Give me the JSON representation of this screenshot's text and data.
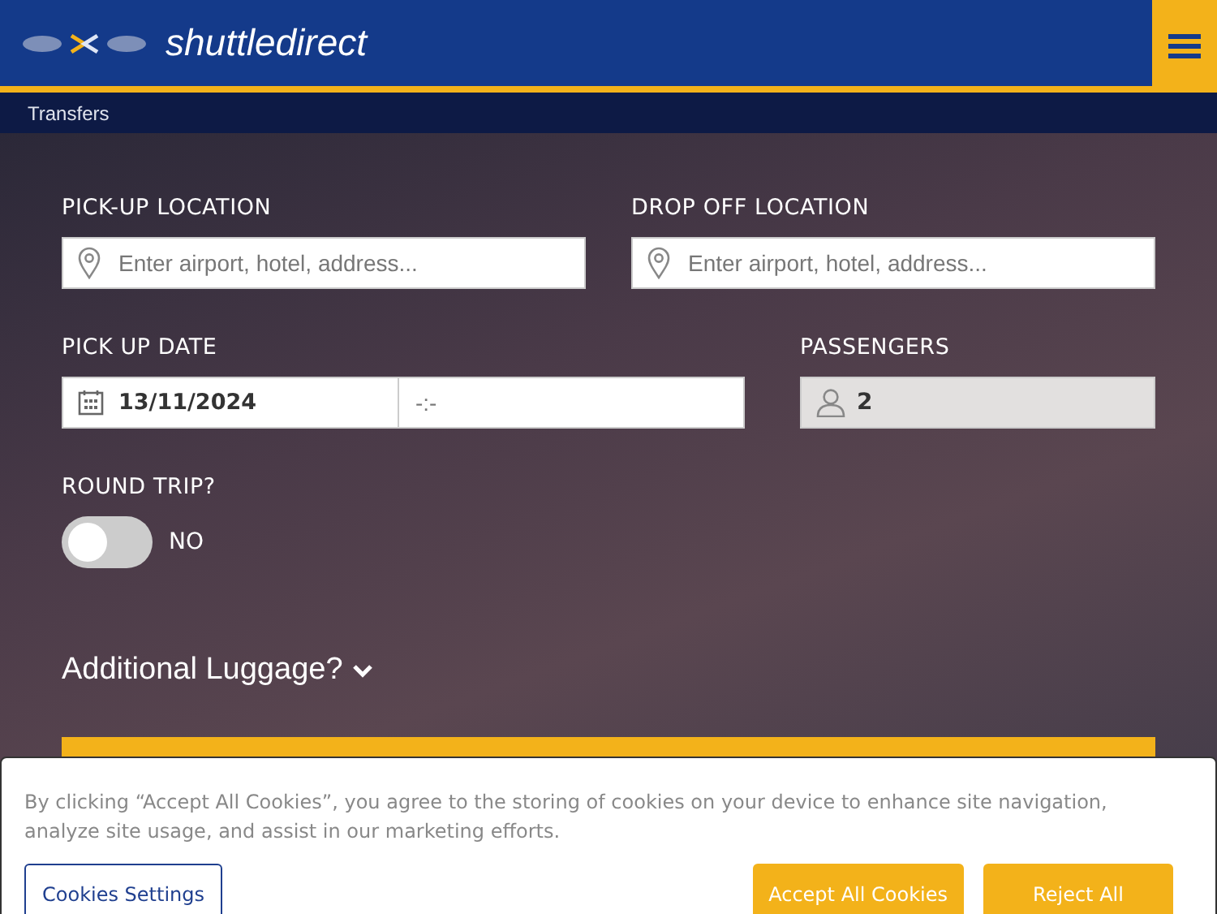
{
  "header": {
    "brand": "shuttledirect"
  },
  "nav": {
    "items": [
      {
        "label": "Transfers"
      }
    ]
  },
  "form": {
    "pickup": {
      "label": "PICK-UP LOCATION",
      "placeholder": "Enter airport, hotel, address..."
    },
    "dropoff": {
      "label": "DROP OFF LOCATION",
      "placeholder": "Enter airport, hotel, address..."
    },
    "date": {
      "label": "PICK UP DATE",
      "value": "13/11/2024",
      "time_placeholder": "-:-"
    },
    "passengers": {
      "label": "PASSENGERS",
      "value": "2",
      "disabled": true
    },
    "round_trip": {
      "label": "ROUND TRIP?",
      "on": false,
      "state_text": "NO"
    },
    "luggage": {
      "label": "Additional Luggage?",
      "expanded": false
    }
  },
  "cookie_banner": {
    "text": "By clicking “Accept All Cookies”, you agree to the storing of cookies on your device to enhance site navigation, analyze site usage, and assist in our marketing efforts.",
    "buttons": [
      {
        "kind": "outline",
        "label": "Cookies Settings"
      },
      {
        "kind": "solid",
        "label": "Accept All Cookies"
      },
      {
        "kind": "solid",
        "label": "Reject All"
      }
    ]
  }
}
